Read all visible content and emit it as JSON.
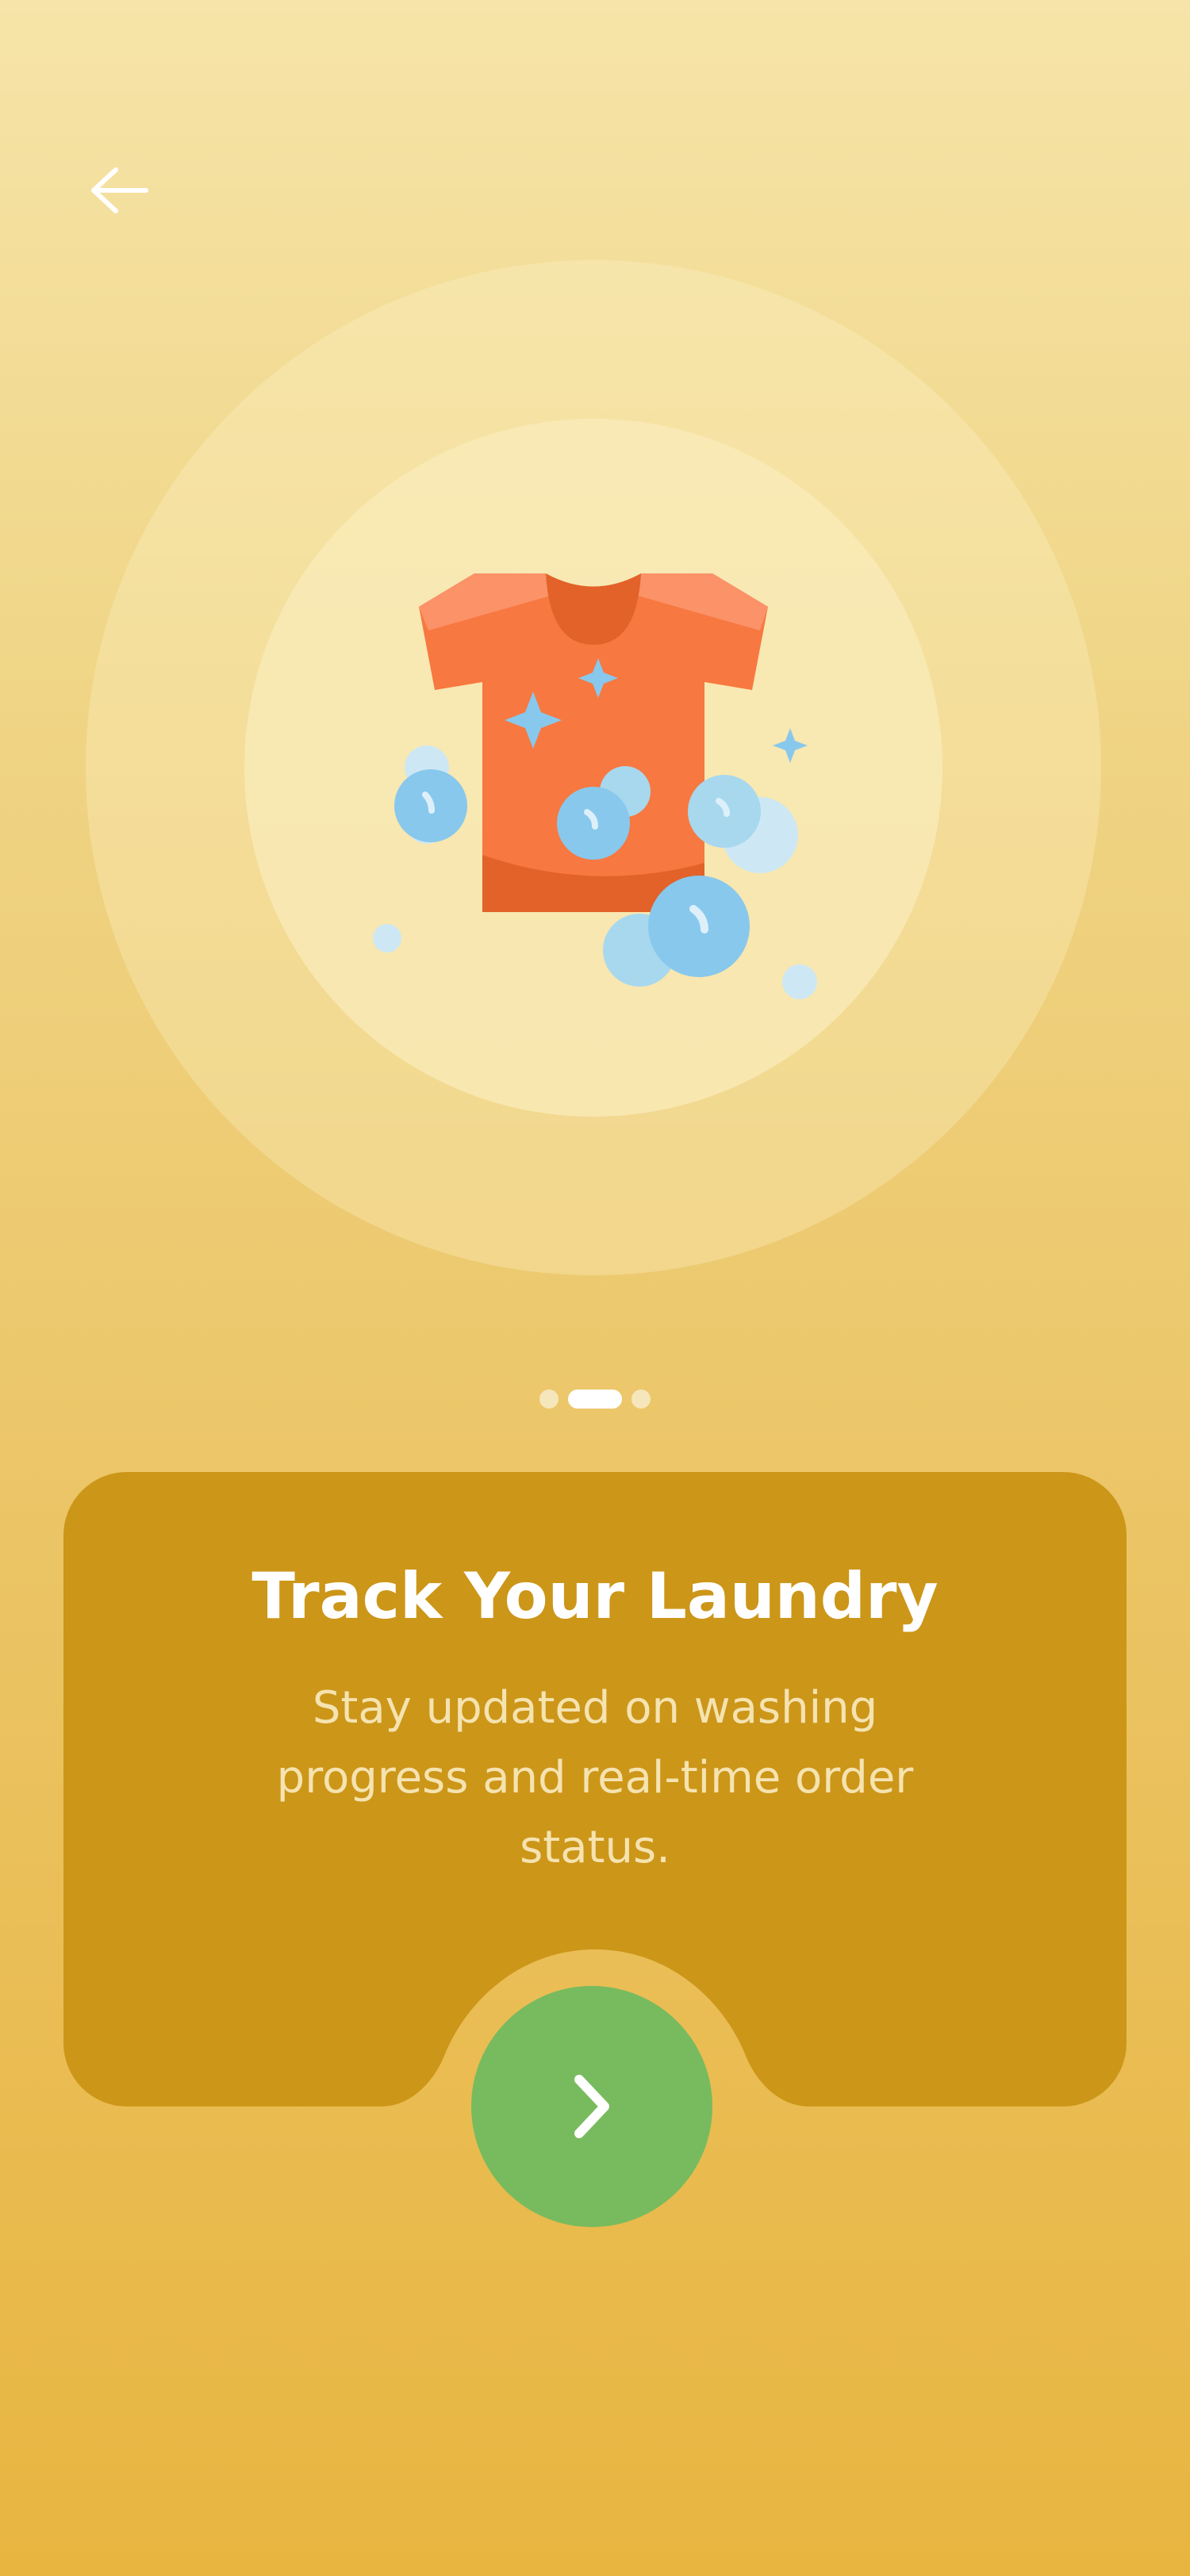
{
  "header": {
    "back_icon": "arrow-left-icon"
  },
  "hero": {
    "illustration": "clean-tshirt-with-bubbles-illustration"
  },
  "pager": {
    "current_page": 2,
    "total_pages": 3
  },
  "card": {
    "title": "Track Your Laundry",
    "description_lines": [
      "Stay updated on washing",
      "progress and real-time order",
      "status."
    ]
  },
  "next_button": {
    "icon": "chevron-right-icon"
  },
  "colors": {
    "background_top": "#F6E4A8",
    "background_bottom": "#E8B540",
    "card": "#CC9619",
    "accent_green": "#78BB5E",
    "shirt": "#F77840",
    "bubble": "#88C8EC"
  }
}
